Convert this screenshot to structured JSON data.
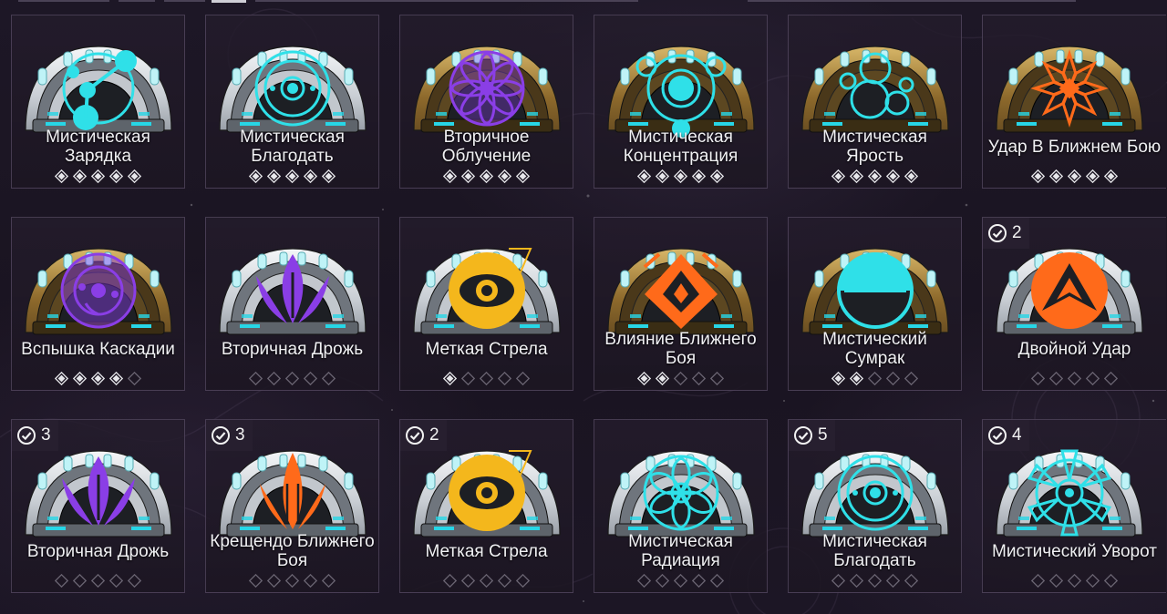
{
  "colors": {
    "cyan": "#2fe0e8",
    "purple": "#8a3ee6",
    "orange": "#ff6a1a",
    "yellow": "#f4b71c",
    "frame_silver": "#d9dde2",
    "frame_gold": "#b58d44"
  },
  "top_tabs": [
    "",
    "",
    "",
    "",
    ""
  ],
  "cards": [
    {
      "name": "Мистическая Зарядка",
      "frame": "silver",
      "symbol": "bonds",
      "color": "cyan",
      "rank": 5,
      "max_rank": 5,
      "badge": null
    },
    {
      "name": "Мистическая Благодать",
      "frame": "silver",
      "symbol": "ring",
      "color": "cyan",
      "rank": 5,
      "max_rank": 5,
      "badge": null
    },
    {
      "name": "Вторичное Облучение",
      "frame": "gold",
      "symbol": "flower",
      "color": "purple",
      "rank": 5,
      "max_rank": 5,
      "badge": null
    },
    {
      "name": "Мистическая Концентрация",
      "frame": "gold",
      "symbol": "focus",
      "color": "cyan",
      "rank": 5,
      "max_rank": 5,
      "badge": null
    },
    {
      "name": "Мистическая Ярость",
      "frame": "gold",
      "symbol": "bubbles",
      "color": "cyan",
      "rank": 5,
      "max_rank": 5,
      "badge": null
    },
    {
      "name": "Удар В Ближнем Бою",
      "frame": "gold",
      "symbol": "snowflake",
      "color": "orange",
      "rank": 5,
      "max_rank": 5,
      "badge": null
    },
    {
      "name": "Вспышка Каскадии",
      "frame": "gold",
      "symbol": "swirl",
      "color": "purple",
      "rank": 4,
      "max_rank": 5,
      "badge": null
    },
    {
      "name": "Вторичная Дрожь",
      "frame": "silver",
      "symbol": "tulip",
      "color": "purple",
      "rank": 0,
      "max_rank": 5,
      "badge": null
    },
    {
      "name": "Меткая Стрела",
      "frame": "silver",
      "symbol": "eye",
      "color": "yellow",
      "rank": 1,
      "max_rank": 5,
      "badge": null
    },
    {
      "name": "Влияние Ближнего Боя",
      "frame": "gold",
      "symbol": "diamond",
      "color": "orange",
      "rank": 2,
      "max_rank": 5,
      "badge": null
    },
    {
      "name": "Мистический Сумрак",
      "frame": "gold",
      "symbol": "halfmoon",
      "color": "cyan",
      "rank": 2,
      "max_rank": 5,
      "badge": null
    },
    {
      "name": "Двойной Удар",
      "frame": "silver",
      "symbol": "arrow",
      "color": "orange",
      "rank": 0,
      "max_rank": 5,
      "badge": "2"
    },
    {
      "name": "Вторичная Дрожь",
      "frame": "silver",
      "symbol": "tulip",
      "color": "purple",
      "rank": 0,
      "max_rank": 5,
      "badge": "3"
    },
    {
      "name": "Крещендо Ближнего Боя",
      "frame": "silver",
      "symbol": "plume",
      "color": "orange",
      "rank": 0,
      "max_rank": 5,
      "badge": "3"
    },
    {
      "name": "Меткая Стрела",
      "frame": "silver",
      "symbol": "eye",
      "color": "yellow",
      "rank": 0,
      "max_rank": 5,
      "badge": "2"
    },
    {
      "name": "Мистическая Радиация",
      "frame": "silver",
      "symbol": "lotus",
      "color": "cyan",
      "rank": 0,
      "max_rank": 5,
      "badge": null
    },
    {
      "name": "Мистическая Благодать",
      "frame": "silver",
      "symbol": "ring",
      "color": "cyan",
      "rank": 0,
      "max_rank": 5,
      "badge": "5"
    },
    {
      "name": "Мистический Уворот",
      "frame": "silver",
      "symbol": "star",
      "color": "cyan",
      "rank": 0,
      "max_rank": 5,
      "badge": "4"
    }
  ]
}
